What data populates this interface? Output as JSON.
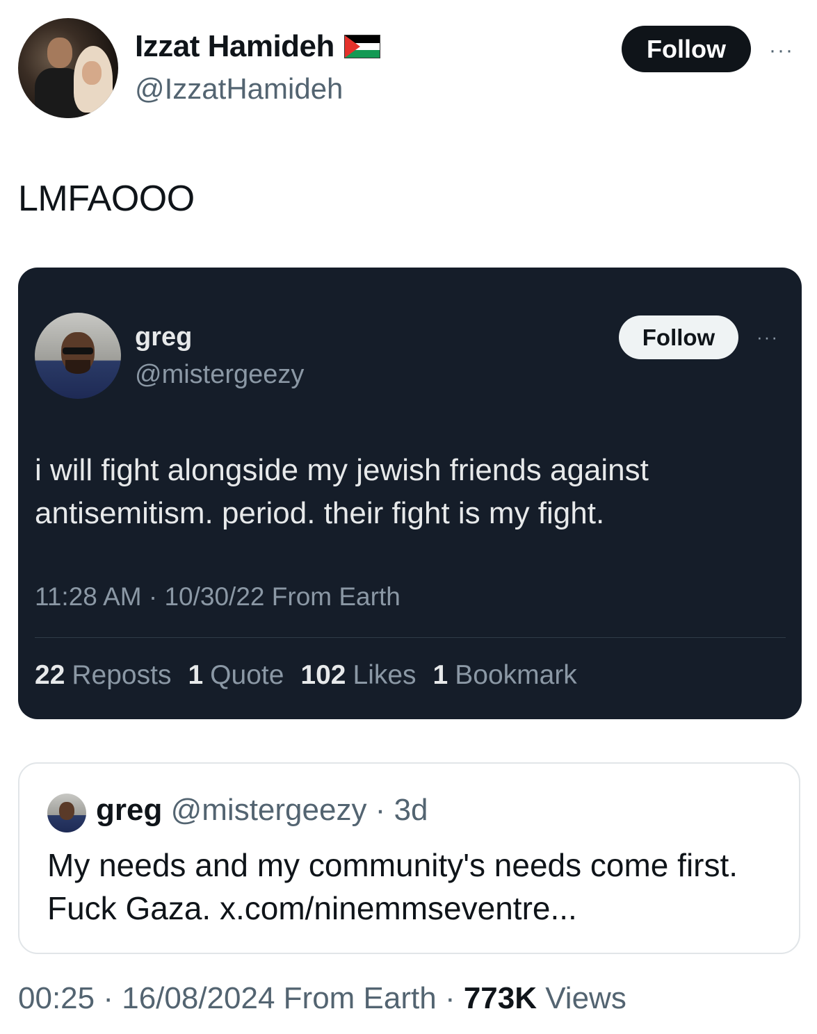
{
  "main_tweet": {
    "author_name": "Izzat Hamideh",
    "flag_icon": "palestine-flag",
    "handle": "@IzzatHamideh",
    "follow_label": "Follow",
    "more_label": "···",
    "text": "LMFAOOO",
    "time": "00:25",
    "date": "16/08/2024",
    "source": "From Earth",
    "views_count": "773K",
    "views_label": "Views"
  },
  "embedded_tweet": {
    "author_name": "greg",
    "handle": "@mistergeezy",
    "follow_label": "Follow",
    "more_label": "···",
    "text": "i will fight alongside my jewish friends against antisemitism. period. their fight is my fight.",
    "meta": "11:28 AM · 10/30/22 From Earth",
    "stats": {
      "reposts_count": "22",
      "reposts_label": "Reposts",
      "quotes_count": "1",
      "quotes_label": "Quote",
      "likes_count": "102",
      "likes_label": "Likes",
      "bookmarks_count": "1",
      "bookmarks_label": "Bookmark"
    }
  },
  "quoted_tweet": {
    "author_name": "greg",
    "handle": "@mistergeezy",
    "age": "3d",
    "text": "My needs and my community's needs come first. Fuck Gaza. x.com/ninemmseventre..."
  },
  "colors": {
    "dark_card_bg": "#151d29",
    "follow_dark": "#0f1419",
    "secondary_text": "#536471"
  }
}
